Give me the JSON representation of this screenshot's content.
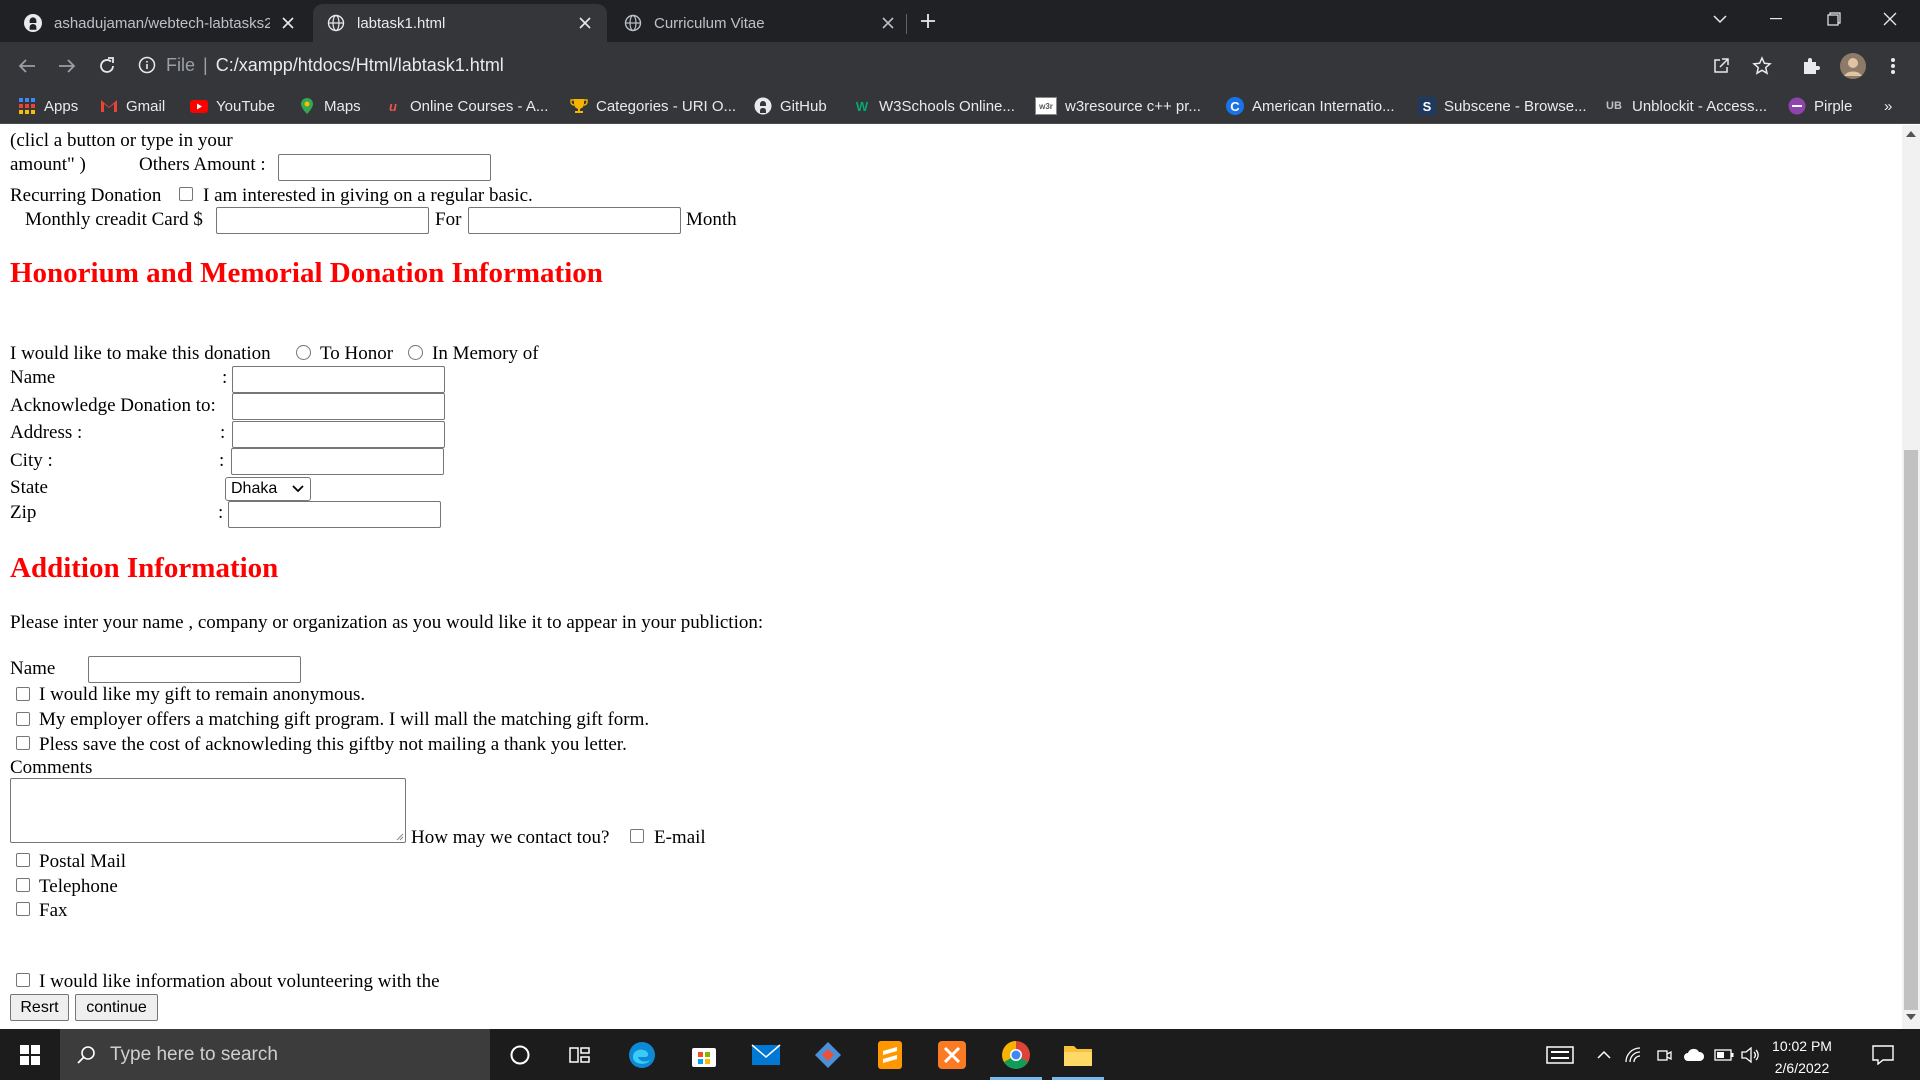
{
  "browser": {
    "tabs": [
      {
        "title": "ashadujaman/webtech-labtasks2",
        "active": false
      },
      {
        "title": "labtask1.html",
        "active": true
      },
      {
        "title": "Curriculum Vitae",
        "active": false
      }
    ],
    "address": {
      "scheme_label": "File",
      "url": "C:/xampp/htdocs/Html/labtask1.html"
    },
    "bookmarks": [
      {
        "label": "Apps",
        "icon": "apps-grid-icon"
      },
      {
        "label": "Gmail",
        "icon": "gmail-icon"
      },
      {
        "label": "YouTube",
        "icon": "youtube-icon"
      },
      {
        "label": "Maps",
        "icon": "maps-icon"
      },
      {
        "label": "Online Courses - A...",
        "icon": "udemy-icon"
      },
      {
        "label": "Categories - URI O...",
        "icon": "trophy-icon"
      },
      {
        "label": "GitHub",
        "icon": "github-icon"
      },
      {
        "label": "W3Schools Online...",
        "icon": "w3schools-icon"
      },
      {
        "label": "w3resource c++ pr...",
        "icon": "w3resource-icon"
      },
      {
        "label": "American Internatio...",
        "icon": "aiub-icon"
      },
      {
        "label": "Subscene - Browse...",
        "icon": "subscene-icon"
      },
      {
        "label": "Unblockit - Access...",
        "icon": "unblockit-icon"
      },
      {
        "label": "Pirple",
        "icon": "pirple-icon"
      }
    ],
    "more_bookmarks": "»"
  },
  "form": {
    "amount_text_1": "(clicl a button or type in your",
    "amount_text_2": "amount\" )",
    "others_amount_label": "Others Amount :",
    "recurring_label": "Recurring Donation",
    "recurring_checkbox_label": "I am interested in giving on a regular basic.",
    "monthly_label": "Monthly creadit Card $",
    "for_label": "For",
    "month_label": "Month",
    "honorium_heading": "Honorium and Memorial Donation Information",
    "donation_intro": "I would like to make this donation",
    "radio_honor": "To Honor",
    "radio_memory": "In Memory of",
    "fields": {
      "name": "Name",
      "acknowledge": "Acknowledge Donation to:",
      "address": "Address :",
      "city": "City :",
      "state": "State",
      "zip": "Zip",
      "colon": ":"
    },
    "state_selected": "Dhaka",
    "addition_heading": "Addition Information",
    "publication_text": "Please inter your name , company or organization as you would like it to appear in your publiction:",
    "name_label": "Name",
    "anonymous_label": "I would like my gift to remain anonymous.",
    "employer_label": "My employer offers a matching gift program. I will mall the matching gift form.",
    "save_cost_label": "Pless save the cost of acknowleding this giftby not mailing a thank you letter.",
    "comments_label": "Comments",
    "contact_question": "How may we contact tou?",
    "contact_email": "E-mail",
    "contact_postal": "Postal Mail",
    "contact_telephone": "Telephone",
    "contact_fax": "Fax",
    "volunteer_label": "I would like information about volunteering with the",
    "reset_button": "Resrt",
    "continue_button": "continue"
  },
  "taskbar": {
    "search_placeholder": "Type here to search",
    "time": "10:02 PM",
    "date": "2/6/2022"
  }
}
